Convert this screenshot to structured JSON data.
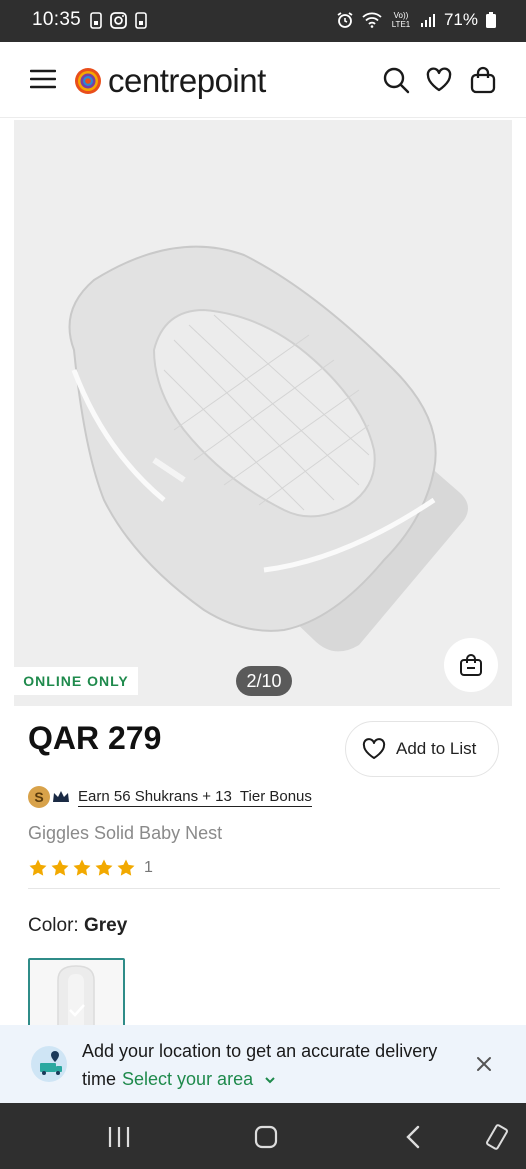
{
  "status_bar": {
    "time": "10:35",
    "battery": "71%",
    "network": "Vo)) LTE1"
  },
  "header": {
    "brand": "centrepoint",
    "icons": [
      "menu-icon",
      "search-icon",
      "heart-icon",
      "bag-icon"
    ]
  },
  "gallery": {
    "badge": "ONLINE ONLY",
    "counter": "2/10",
    "current_image": 2,
    "total_images": 10
  },
  "product": {
    "price": "QAR 279",
    "add_to_list": "Add to List",
    "shukran_text": "Earn 56 Shukrans + 13  Tier Bonus",
    "name": "Giggles Solid Baby Nest",
    "rating": 5,
    "rating_count": "1",
    "color_label": "Color:",
    "color_value": "Grey"
  },
  "location_banner": {
    "message": "Add your location to get an accurate delivery time",
    "action": "Select your area"
  },
  "colors": {
    "accent_green": "#1f8a4c",
    "star": "#f2a900",
    "swatch_border": "#2f8c88"
  }
}
